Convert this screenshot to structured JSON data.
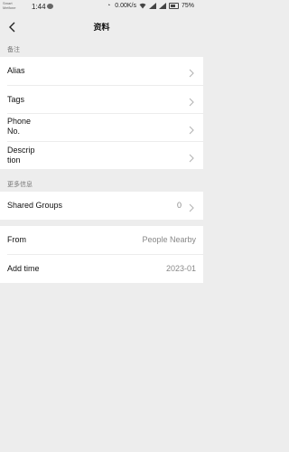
{
  "statusbar": {
    "carrier": "Smart\nMetfone",
    "time": "1:44",
    "speed": "0.00K/s",
    "battery": "75%"
  },
  "header": {
    "title": "资料"
  },
  "section_remarks": {
    "label": "备注",
    "rows": [
      {
        "label": "Alias"
      },
      {
        "label": "Tags"
      },
      {
        "label": "Phone\nNo."
      },
      {
        "label": "Descrip\ntion"
      }
    ]
  },
  "section_more": {
    "label": "更多信息",
    "shared_groups": {
      "label": "Shared Groups",
      "value": "0"
    }
  },
  "section_info": {
    "from": {
      "label": "From",
      "value": "People Nearby"
    },
    "add_time": {
      "label": "Add time",
      "value": "2023-01"
    }
  }
}
